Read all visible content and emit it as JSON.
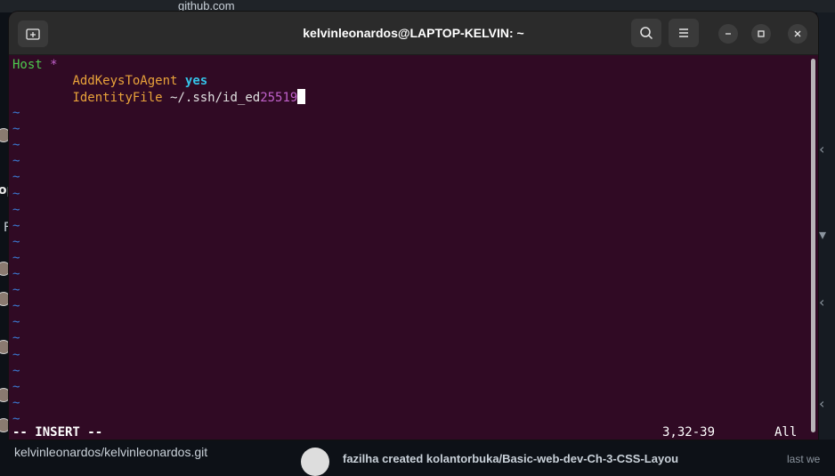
{
  "background": {
    "url_text": "github.com",
    "bottom_repo": "kelvinleonardos/kelvinleonardos.git",
    "bottom_feed": "fazilha created kolantorbuka/Basic-web-dev-Ch-3-CSS-Layou",
    "bottom_feed_time": "last we",
    "side_letters": [
      "op",
      "F"
    ]
  },
  "window": {
    "title": "kelvinleonardos@LAPTOP-KELVIN: ~",
    "icons": {
      "new_tab": "new-tab-icon",
      "search": "search-icon",
      "menu": "hamburger-menu-icon",
      "minimize": "minimize-icon",
      "maximize": "maximize-icon",
      "close": "close-icon"
    }
  },
  "editor": {
    "lines": {
      "host_keyword": "Host",
      "host_value": "*",
      "addkeys_key": "AddKeysToAgent",
      "addkeys_value": "yes",
      "identity_key": "IdentityFile",
      "identity_value_prefix": "~/.ssh/id_ed",
      "identity_value_suffix": "25519"
    },
    "tilde_char": "~",
    "tilde_count": 20,
    "mode": "-- INSERT --",
    "cursor_position": "3,32-39",
    "scroll_position": "All"
  },
  "colors": {
    "terminal_bg": "#300a24",
    "titlebar_bg": "#2b2b2b",
    "host_keyword": "#4ec94e",
    "keyword_orange": "#e9a33a",
    "value_cyan": "#34c3e8",
    "number_magenta": "#c061cb",
    "tilde_blue": "#3b7bd4"
  }
}
